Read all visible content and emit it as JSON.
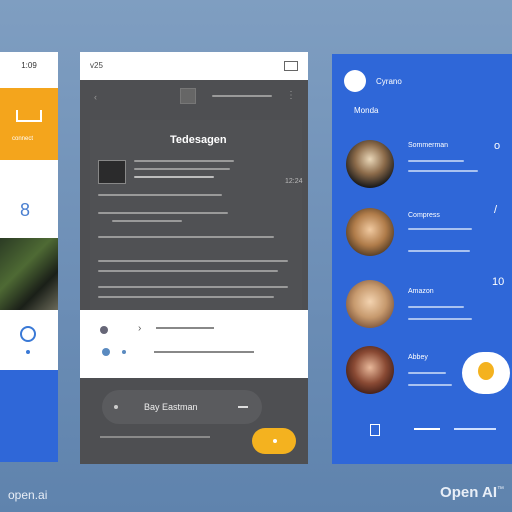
{
  "left_panel": {
    "top_label": "1:09",
    "orange_label": "connect",
    "ring_glyph": "8"
  },
  "center_panel": {
    "header_label": "v25",
    "card_title": "Tedesagen",
    "timestamp": "12:24",
    "player_text": "Bay Eastman"
  },
  "right_panel": {
    "user_name": "Cyrano",
    "section_label": "Monda",
    "contacts": [
      {
        "name": "Sommerman",
        "badge": "o"
      },
      {
        "name": "Compress",
        "badge": "/"
      },
      {
        "name": "Amazon",
        "badge": "10"
      },
      {
        "name": "Abbey",
        "badge": ""
      }
    ]
  },
  "branding": {
    "left": "open.ai",
    "right": "Open AI",
    "right_mark": "™"
  },
  "colors": {
    "blue": "#2f67d8",
    "orange": "#f4a51c",
    "dark": "#4e4f52",
    "yellow": "#f4b21f"
  }
}
